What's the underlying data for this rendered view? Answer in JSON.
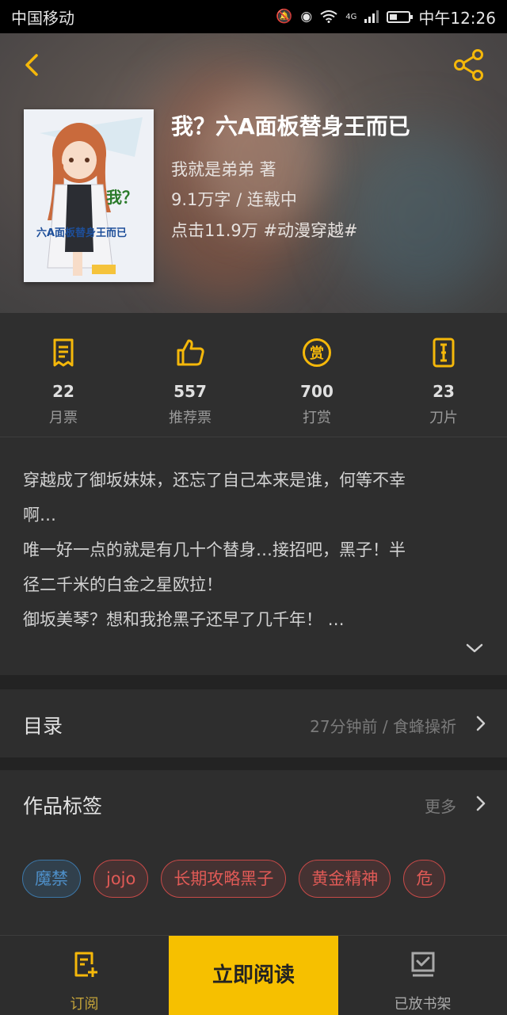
{
  "status_bar": {
    "carrier": "中国移动",
    "network": "4G",
    "time": "中午12:26"
  },
  "book": {
    "title": "我？六A面板替身王而已",
    "author_line": "我就是弟弟  著",
    "words_status": "9.1万字 / 连载中",
    "clicks_tag": "点击11.9万  #动漫穿越#",
    "cover_text": "六A面板替身王而已",
    "cover_mark": "我？"
  },
  "stats": [
    {
      "icon": "monthly-ticket-icon",
      "value": "22",
      "label": "月票"
    },
    {
      "icon": "thumbs-up-icon",
      "value": "557",
      "label": "推荐票"
    },
    {
      "icon": "reward-coin-icon",
      "value": "700",
      "label": "打赏"
    },
    {
      "icon": "blade-card-icon",
      "value": "23",
      "label": "刀片"
    }
  ],
  "intro": {
    "line1": "穿越成了御坂妹妹，还忘了自己本来是谁，何等不幸",
    "line2": "啊…",
    "line3": "唯一好一点的就是有几十个替身…接招吧，黑子！半",
    "line4": "径二千米的白金之星欧拉！",
    "line5": "御坂美琴？想和我抢黑子还早了几千年！ …"
  },
  "catalog": {
    "title": "目录",
    "latest": "27分钟前 / 食蜂操祈"
  },
  "tags_section": {
    "title": "作品标签",
    "more": "更多",
    "tags": [
      "魔禁",
      "jojo",
      "长期攻略黑子",
      "黄金精神",
      "危"
    ]
  },
  "bottom_bar": {
    "subscribe": "订阅",
    "read_now": "立即阅读",
    "shelved": "已放书架"
  },
  "colors": {
    "accent": "#f6c000",
    "icon_yellow": "#f5b80a",
    "tag_red": "#e05a56",
    "tag_blue": "#4e8fc8"
  }
}
